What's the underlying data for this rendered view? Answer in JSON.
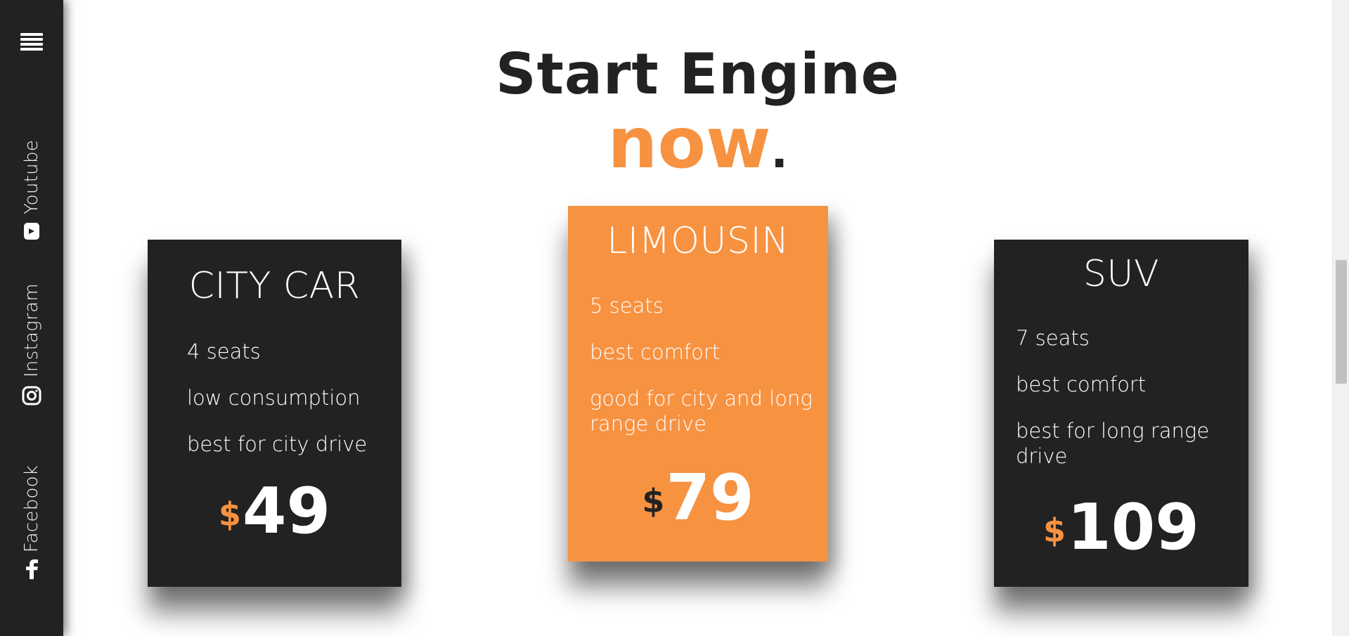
{
  "sidebar": {
    "menu_icon": "hamburger-menu-icon",
    "links": [
      {
        "label": "Youtube",
        "icon": "youtube-icon"
      },
      {
        "label": "Instagram",
        "icon": "instagram-icon"
      },
      {
        "label": "Facebook",
        "icon": "facebook-icon"
      }
    ]
  },
  "heading": {
    "line1": "Start Engine",
    "accent": "now",
    "dot": "."
  },
  "colors": {
    "accent": "#f79241",
    "dark": "#222222",
    "white": "#ffffff"
  },
  "cards": [
    {
      "title": "CITY CAR",
      "features": [
        "4 seats",
        "low consumption",
        "best for city drive"
      ],
      "currency": "$",
      "price": "49",
      "style": "dark"
    },
    {
      "title": "LIMOUSIN",
      "features": [
        "5 seats",
        "best comfort",
        "good for city and long range drive"
      ],
      "currency": "$",
      "price": "79",
      "style": "orange"
    },
    {
      "title": "SUV",
      "features": [
        "7 seats",
        "best comfort",
        "best for long range drive"
      ],
      "currency": "$",
      "price": "109",
      "style": "dark"
    }
  ]
}
